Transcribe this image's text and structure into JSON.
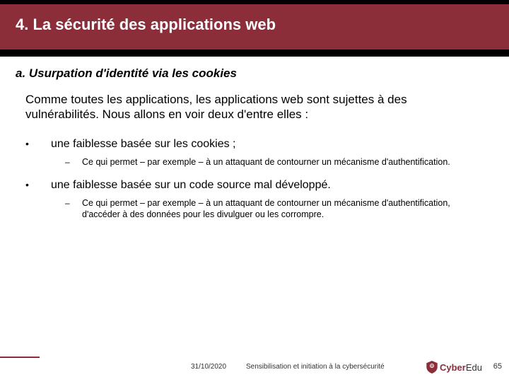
{
  "title": "4. La sécurité des applications web",
  "subtitle": "a. Usurpation d'identité via les cookies",
  "intro": "Comme toutes les applications, les applications web sont sujettes à des vulnérabilités. Nous allons en voir deux d'entre elles :",
  "bullets": [
    {
      "text": "une faiblesse basée sur les cookies ;",
      "sub": "Ce qui permet – par exemple – à un attaquant de contourner un mécanisme d'authentification."
    },
    {
      "text": "une faiblesse basée sur un code source mal développé.",
      "sub": "Ce qui permet – par exemple – à un attaquant de contourner un mécanisme d'authentification, d'accéder à des données pour les divulguer ou les corrompre."
    }
  ],
  "footer": {
    "date": "31/10/2020",
    "text": "Sensibilisation et initiation à la cybersécurité",
    "brand1": "Cyber",
    "brand2": "Edu",
    "page": "65"
  }
}
